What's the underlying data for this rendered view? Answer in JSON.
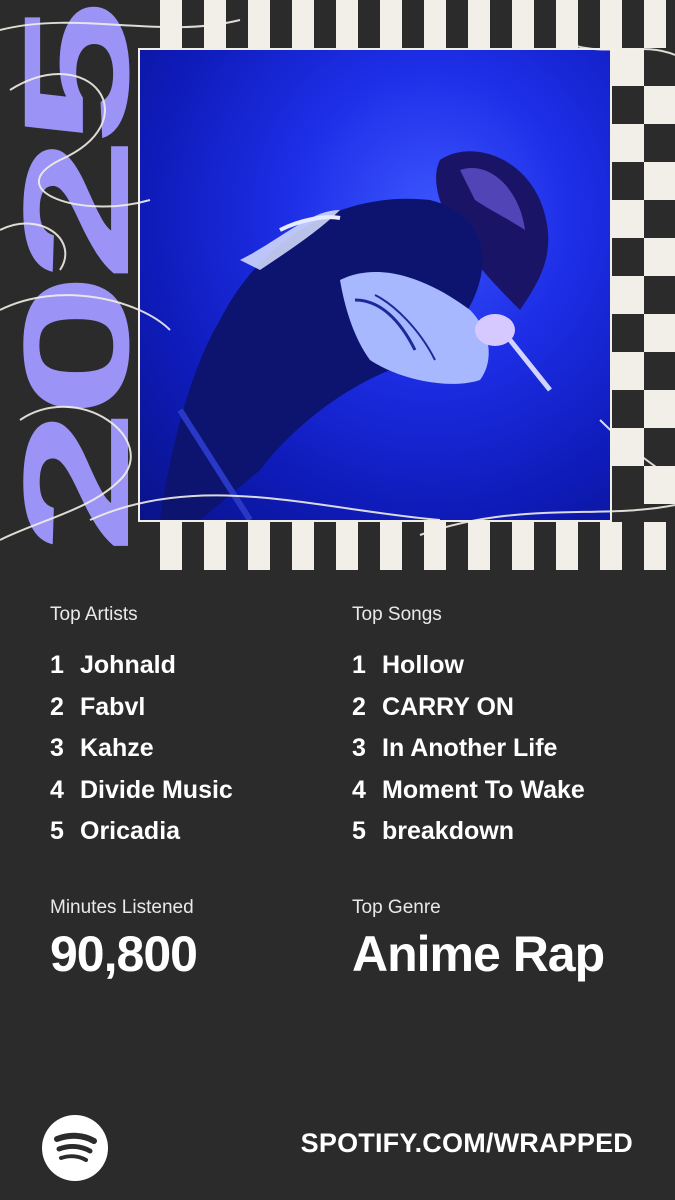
{
  "year_art": {
    "text": "2025",
    "accent_color": "#9b93f5"
  },
  "photo": {
    "description_icon": "artist-photo",
    "tint": "#1d2ee6"
  },
  "top_artists": {
    "label": "Top Artists",
    "items": [
      {
        "rank": "1",
        "name": "Johnald"
      },
      {
        "rank": "2",
        "name": "Fabvl"
      },
      {
        "rank": "3",
        "name": "Kahze"
      },
      {
        "rank": "4",
        "name": "Divide Music"
      },
      {
        "rank": "5",
        "name": "Oricadia"
      }
    ]
  },
  "top_songs": {
    "label": "Top Songs",
    "items": [
      {
        "rank": "1",
        "name": "Hollow"
      },
      {
        "rank": "2",
        "name": "CARRY ON"
      },
      {
        "rank": "3",
        "name": "In Another Life"
      },
      {
        "rank": "4",
        "name": "Moment To Wake"
      },
      {
        "rank": "5",
        "name": "breakdown"
      }
    ]
  },
  "minutes": {
    "label": "Minutes Listened",
    "value": "90,800"
  },
  "genre": {
    "label": "Top Genre",
    "value": "Anime Rap"
  },
  "footer": {
    "logo_icon": "spotify-icon",
    "url": "SPOTIFY.COM/WRAPPED"
  }
}
